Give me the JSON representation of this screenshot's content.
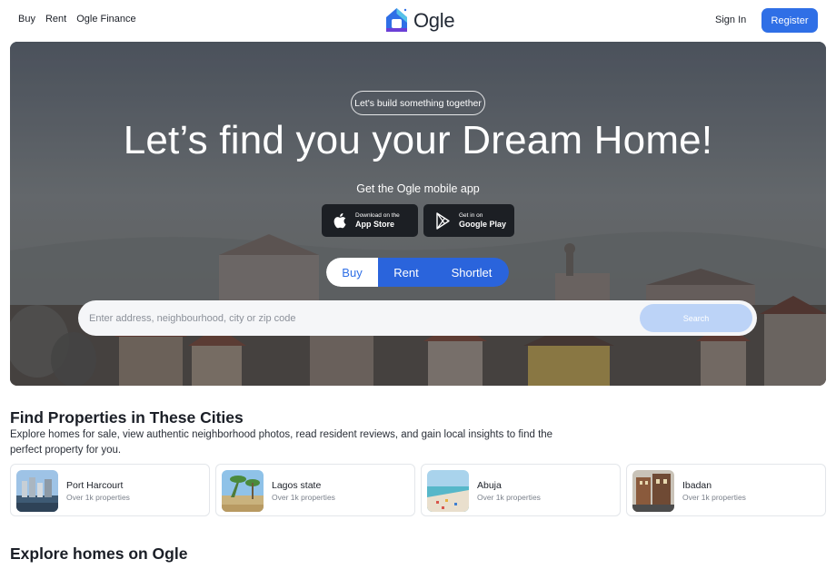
{
  "nav": {
    "links": [
      "Buy",
      "Rent",
      "Ogle Finance"
    ],
    "brand": "Ogle",
    "signin_label": "Sign In",
    "register_label": "Register"
  },
  "hero": {
    "pill": "Let's build something together",
    "headline": "Let’s find you your Dream Home!",
    "app_label": "Get the Ogle mobile app",
    "app_store": {
      "small": "Download on the",
      "big": "App Store"
    },
    "google_play": {
      "small": "Get in on",
      "big": "Google Play"
    },
    "tabs": [
      "Buy",
      "Rent",
      "Shortlet"
    ],
    "active_tab": "Buy",
    "search": {
      "placeholder": "Enter address, neighbourhood, city or zip code",
      "button": "Search"
    }
  },
  "cities_section": {
    "title": "Find Properties in These Cities",
    "description": "Explore homes for sale, view authentic neighborhood photos, read resident reviews, and gain local insights to find the perfect property for you.",
    "cities": [
      {
        "name": "Port Harcourt",
        "count": "Over 1k properties"
      },
      {
        "name": "Lagos state",
        "count": "Over 1k properties"
      },
      {
        "name": "Abuja",
        "count": "Over 1k properties"
      },
      {
        "name": "Ibadan",
        "count": "Over 1k properties"
      }
    ]
  },
  "explore_section": {
    "title": "Explore homes on Ogle"
  },
  "colors": {
    "accent": "#2f6fe6",
    "search_button": "#bcd3f7",
    "store_button": "#1c1f24"
  }
}
